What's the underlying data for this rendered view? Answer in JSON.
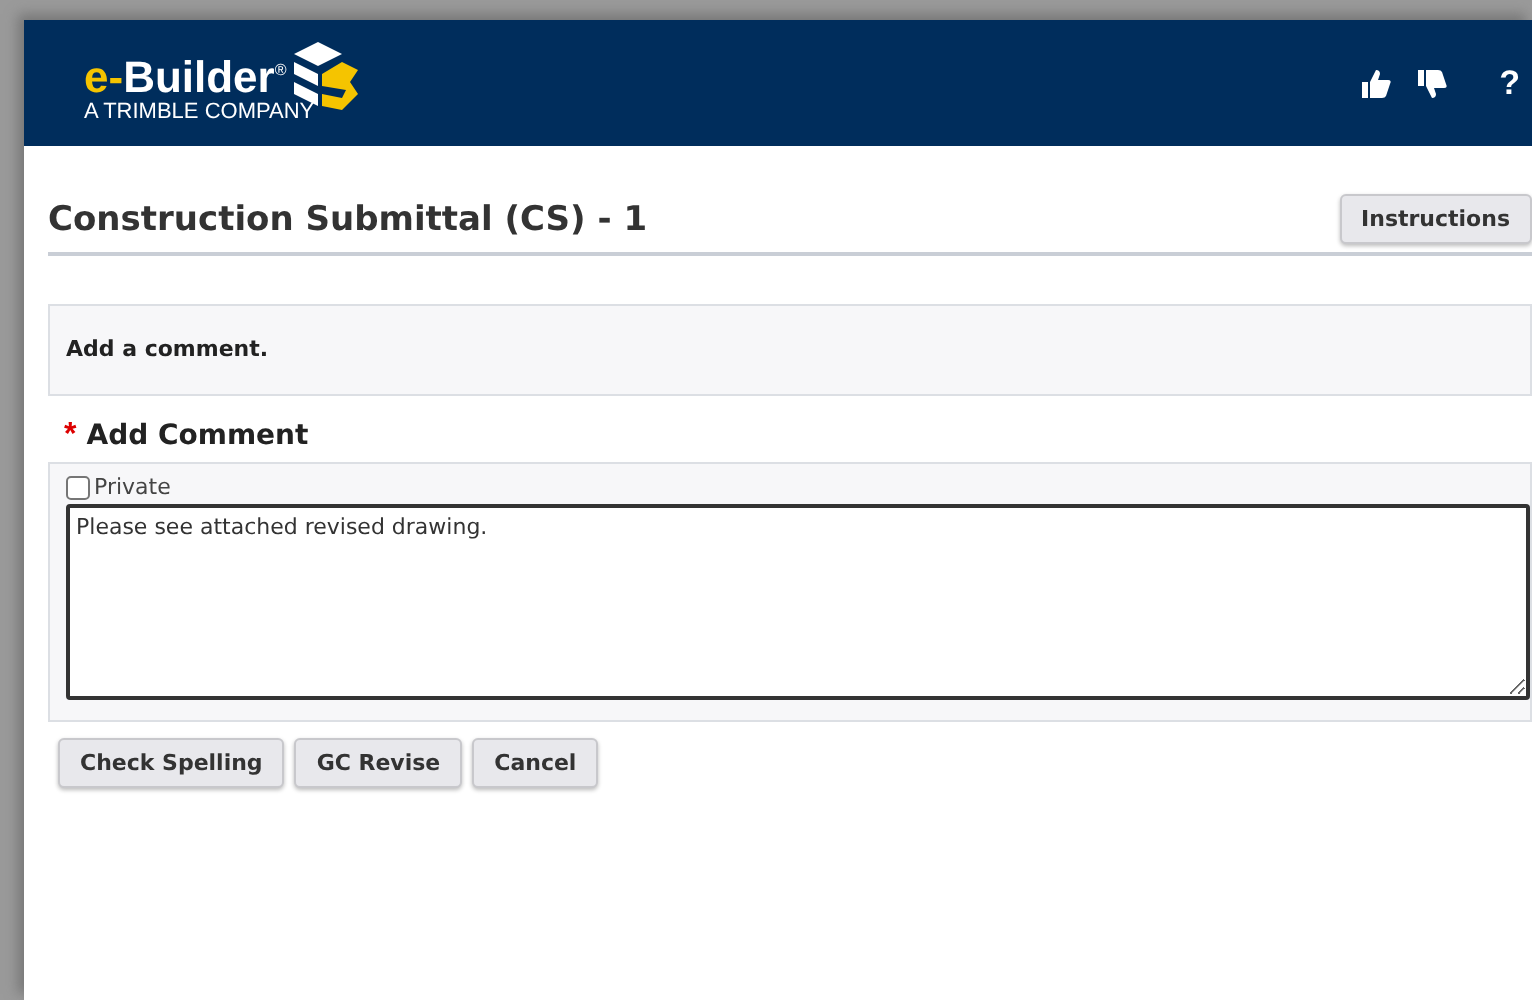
{
  "header": {
    "brand_prefix": "e-",
    "brand_name": "Builder$^{®}$",
    "tagline": "A TRIMBLE COMPANY",
    "help": "?"
  },
  "page": {
    "title": "Construction Submittal (CS) - 1",
    "instructions_button": "Instructions"
  },
  "info": {
    "text": "Add a comment."
  },
  "comment": {
    "required_mark": "*",
    "heading": "Add Comment",
    "private": {
      "label": "Private",
      "checked": false
    },
    "value": "Please see attached revised drawing."
  },
  "buttons": [
    "Check Spelling",
    "GC Revise",
    "Cancel"
  ]
}
